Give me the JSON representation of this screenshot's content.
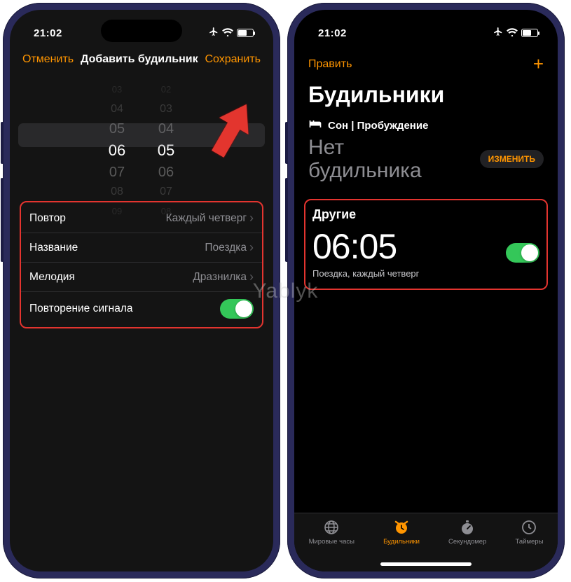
{
  "status": {
    "time": "21:02",
    "battery_pct": 61
  },
  "left": {
    "cancel": "Отменить",
    "title": "Добавить будильник",
    "save": "Сохранить",
    "picker": {
      "hours": [
        "03",
        "04",
        "05",
        "06",
        "07",
        "08",
        "09"
      ],
      "minutes": [
        "02",
        "03",
        "04",
        "05",
        "06",
        "07",
        "08"
      ]
    },
    "rows": {
      "repeat_label": "Повтор",
      "repeat_value": "Каждый четверг",
      "name_label": "Название",
      "name_value": "Поездка",
      "sound_label": "Мелодия",
      "sound_value": "Дразнилка",
      "snooze_label": "Повторение сигнала"
    }
  },
  "right": {
    "edit": "Править",
    "big_title": "Будильники",
    "sleep_header": "Сон | Пробуждение",
    "no_alarm_line1": "Нет",
    "no_alarm_line2": "будильника",
    "change": "ИЗМЕНИТЬ",
    "other_header": "Другие",
    "alarm_time": "06:05",
    "alarm_sub": "Поездка, каждый четверг",
    "tabs": {
      "world": "Мировые часы",
      "alarm": "Будильники",
      "stopwatch": "Секундомер",
      "timer": "Таймеры"
    }
  },
  "watermark": "Yablyk"
}
